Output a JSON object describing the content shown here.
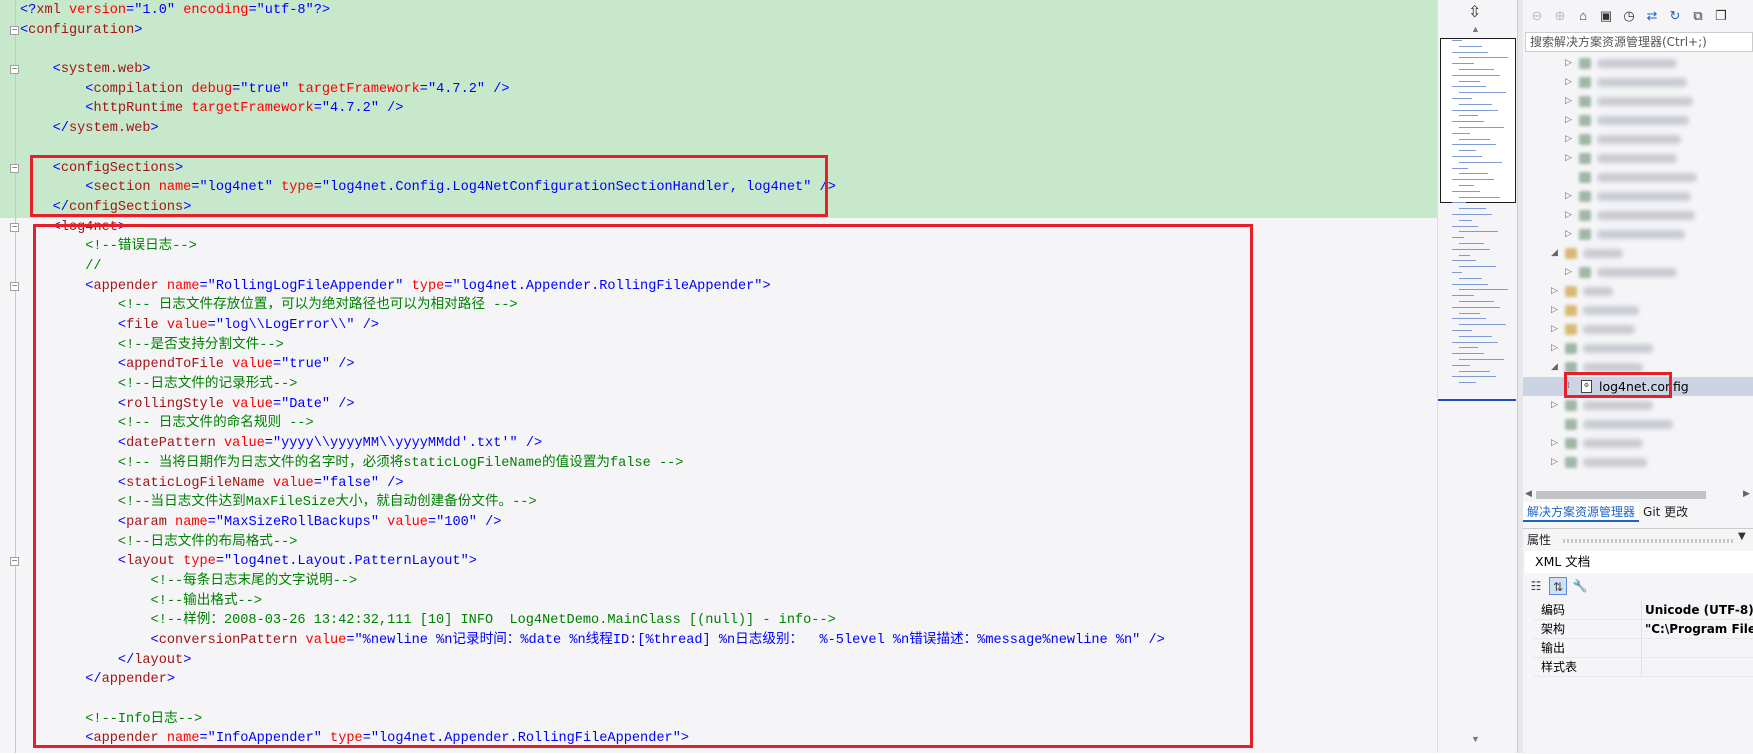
{
  "editor": {
    "lines": [
      {
        "fold": false,
        "indent": 0,
        "tokens": [
          [
            "br",
            "<?"
          ],
          [
            "tag",
            "xml"
          ],
          [
            "attr",
            " version"
          ],
          [
            "br",
            "="
          ],
          [
            "val",
            "\"1.0\""
          ],
          [
            "attr",
            " encoding"
          ],
          [
            "br",
            "="
          ],
          [
            "val",
            "\"utf-8\""
          ],
          [
            "br",
            "?>"
          ]
        ]
      },
      {
        "fold": true,
        "indent": 0,
        "tokens": [
          [
            "br",
            "<"
          ],
          [
            "tag",
            "configuration"
          ],
          [
            "br",
            ">"
          ]
        ]
      },
      {
        "fold": false,
        "indent": 0,
        "tokens": []
      },
      {
        "fold": true,
        "indent": 1,
        "tokens": [
          [
            "br",
            "<"
          ],
          [
            "tag",
            "system.web"
          ],
          [
            "br",
            ">"
          ]
        ]
      },
      {
        "fold": false,
        "indent": 2,
        "tokens": [
          [
            "br",
            "<"
          ],
          [
            "tag",
            "compilation"
          ],
          [
            "attr",
            " debug"
          ],
          [
            "br",
            "="
          ],
          [
            "val",
            "\"true\""
          ],
          [
            "attr",
            " targetFramework"
          ],
          [
            "br",
            "="
          ],
          [
            "val",
            "\"4.7.2\""
          ],
          [
            "br",
            " />"
          ]
        ]
      },
      {
        "fold": false,
        "indent": 2,
        "tokens": [
          [
            "br",
            "<"
          ],
          [
            "tag",
            "httpRuntime"
          ],
          [
            "attr",
            " targetFramework"
          ],
          [
            "br",
            "="
          ],
          [
            "val",
            "\"4.7.2\""
          ],
          [
            "br",
            " />"
          ]
        ]
      },
      {
        "fold": false,
        "indent": 1,
        "tokens": [
          [
            "br",
            "</"
          ],
          [
            "tag",
            "system.web"
          ],
          [
            "br",
            ">"
          ]
        ]
      },
      {
        "fold": false,
        "indent": 0,
        "tokens": []
      },
      {
        "fold": true,
        "indent": 1,
        "tokens": [
          [
            "br",
            "<"
          ],
          [
            "tag",
            "configSections"
          ],
          [
            "br",
            ">"
          ]
        ]
      },
      {
        "fold": false,
        "indent": 2,
        "tokens": [
          [
            "br",
            "<"
          ],
          [
            "tag",
            "section"
          ],
          [
            "attr",
            " name"
          ],
          [
            "br",
            "="
          ],
          [
            "val",
            "\"log4net\""
          ],
          [
            "attr",
            " type"
          ],
          [
            "br",
            "="
          ],
          [
            "val",
            "\"log4net.Config.Log4NetConfigurationSectionHandler, log4net\""
          ],
          [
            "br",
            " />"
          ]
        ]
      },
      {
        "fold": false,
        "indent": 1,
        "tokens": [
          [
            "br",
            "</"
          ],
          [
            "tag",
            "configSections"
          ],
          [
            "br",
            ">"
          ]
        ]
      },
      {
        "fold": true,
        "indent": 1,
        "tokens": [
          [
            "br",
            "<"
          ],
          [
            "tag",
            "log4net"
          ],
          [
            "br",
            ">"
          ]
        ]
      },
      {
        "fold": false,
        "indent": 2,
        "tokens": [
          [
            "cmt",
            "<!--错误日志-->"
          ]
        ]
      },
      {
        "fold": false,
        "indent": 2,
        "tokens": [
          [
            "cmt",
            "//"
          ]
        ]
      },
      {
        "fold": true,
        "indent": 2,
        "tokens": [
          [
            "br",
            "<"
          ],
          [
            "tag",
            "appender"
          ],
          [
            "attr",
            " name"
          ],
          [
            "br",
            "="
          ],
          [
            "val",
            "\"RollingLogFileAppender\""
          ],
          [
            "attr",
            " type"
          ],
          [
            "br",
            "="
          ],
          [
            "val",
            "\"log4net.Appender.RollingFileAppender\""
          ],
          [
            "br",
            ">"
          ]
        ]
      },
      {
        "fold": false,
        "indent": 3,
        "tokens": [
          [
            "cmt",
            "<!-- 日志文件存放位置，可以为绝对路径也可以为相对路径 -->"
          ]
        ]
      },
      {
        "fold": false,
        "indent": 3,
        "tokens": [
          [
            "br",
            "<"
          ],
          [
            "tag",
            "file"
          ],
          [
            "attr",
            " value"
          ],
          [
            "br",
            "="
          ],
          [
            "val",
            "\"log\\\\LogError\\\\\""
          ],
          [
            "br",
            " />"
          ]
        ]
      },
      {
        "fold": false,
        "indent": 3,
        "tokens": [
          [
            "cmt",
            "<!--是否支持分割文件-->"
          ]
        ]
      },
      {
        "fold": false,
        "indent": 3,
        "tokens": [
          [
            "br",
            "<"
          ],
          [
            "tag",
            "appendToFile"
          ],
          [
            "attr",
            " value"
          ],
          [
            "br",
            "="
          ],
          [
            "val",
            "\"true\""
          ],
          [
            "br",
            " />"
          ]
        ]
      },
      {
        "fold": false,
        "indent": 3,
        "tokens": [
          [
            "cmt",
            "<!--日志文件的记录形式-->"
          ]
        ]
      },
      {
        "fold": false,
        "indent": 3,
        "tokens": [
          [
            "br",
            "<"
          ],
          [
            "tag",
            "rollingStyle"
          ],
          [
            "attr",
            " value"
          ],
          [
            "br",
            "="
          ],
          [
            "val",
            "\"Date\""
          ],
          [
            "br",
            " />"
          ]
        ]
      },
      {
        "fold": false,
        "indent": 3,
        "tokens": [
          [
            "cmt",
            "<!-- 日志文件的命名规则 -->"
          ]
        ]
      },
      {
        "fold": false,
        "indent": 3,
        "tokens": [
          [
            "br",
            "<"
          ],
          [
            "tag",
            "datePattern"
          ],
          [
            "attr",
            " value"
          ],
          [
            "br",
            "="
          ],
          [
            "val",
            "\"yyyy\\\\yyyyMM\\\\yyyyMMdd'.txt'\""
          ],
          [
            "br",
            " />"
          ]
        ]
      },
      {
        "fold": false,
        "indent": 3,
        "tokens": [
          [
            "cmt",
            "<!-- 当将日期作为日志文件的名字时，必须将staticLogFileName的值设置为false -->"
          ]
        ]
      },
      {
        "fold": false,
        "indent": 3,
        "tokens": [
          [
            "br",
            "<"
          ],
          [
            "tag",
            "staticLogFileName"
          ],
          [
            "attr",
            " value"
          ],
          [
            "br",
            "="
          ],
          [
            "val",
            "\"false\""
          ],
          [
            "br",
            " />"
          ]
        ]
      },
      {
        "fold": false,
        "indent": 3,
        "tokens": [
          [
            "cmt",
            "<!--当日志文件达到MaxFileSize大小，就自动创建备份文件。-->"
          ]
        ]
      },
      {
        "fold": false,
        "indent": 3,
        "tokens": [
          [
            "br",
            "<"
          ],
          [
            "tag",
            "param"
          ],
          [
            "attr",
            " name"
          ],
          [
            "br",
            "="
          ],
          [
            "val",
            "\"MaxSizeRollBackups\""
          ],
          [
            "attr",
            " value"
          ],
          [
            "br",
            "="
          ],
          [
            "val",
            "\"100\""
          ],
          [
            "br",
            " />"
          ]
        ]
      },
      {
        "fold": false,
        "indent": 3,
        "tokens": [
          [
            "cmt",
            "<!--日志文件的布局格式-->"
          ]
        ]
      },
      {
        "fold": true,
        "indent": 3,
        "tokens": [
          [
            "br",
            "<"
          ],
          [
            "tag",
            "layout"
          ],
          [
            "attr",
            " type"
          ],
          [
            "br",
            "="
          ],
          [
            "val",
            "\"log4net.Layout.PatternLayout\""
          ],
          [
            "br",
            ">"
          ]
        ]
      },
      {
        "fold": false,
        "indent": 4,
        "tokens": [
          [
            "cmt",
            "<!--每条日志末尾的文字说明-->"
          ]
        ]
      },
      {
        "fold": false,
        "indent": 4,
        "tokens": [
          [
            "cmt",
            "<!--输出格式-->"
          ]
        ]
      },
      {
        "fold": false,
        "indent": 4,
        "tokens": [
          [
            "cmt",
            "<!--样例：2008-03-26 13:42:32,111 [10] INFO  Log4NetDemo.MainClass [(null)] - info-->"
          ]
        ]
      },
      {
        "fold": false,
        "indent": 4,
        "tokens": [
          [
            "br",
            "<"
          ],
          [
            "tag",
            "conversionPattern"
          ],
          [
            "attr",
            " value"
          ],
          [
            "br",
            "="
          ],
          [
            "val",
            "\"%newline %n记录时间：%date %n线程ID:[%thread] %n日志级别：  %-5level %n错误描述：%message%newline %n\""
          ],
          [
            "br",
            " />"
          ]
        ]
      },
      {
        "fold": false,
        "indent": 3,
        "tokens": [
          [
            "br",
            "</"
          ],
          [
            "tag",
            "layout"
          ],
          [
            "br",
            ">"
          ]
        ]
      },
      {
        "fold": false,
        "indent": 2,
        "tokens": [
          [
            "br",
            "</"
          ],
          [
            "tag",
            "appender"
          ],
          [
            "br",
            ">"
          ]
        ]
      },
      {
        "fold": false,
        "indent": 0,
        "tokens": []
      },
      {
        "fold": false,
        "indent": 2,
        "tokens": [
          [
            "cmt",
            "<!--Info日志-->"
          ]
        ]
      },
      {
        "fold": false,
        "indent": 2,
        "tokens": [
          [
            "br",
            "<"
          ],
          [
            "tag",
            "appender"
          ],
          [
            "attr",
            " name"
          ],
          [
            "br",
            "="
          ],
          [
            "val",
            "\"InfoAppender\""
          ],
          [
            "attr",
            " type"
          ],
          [
            "br",
            "="
          ],
          [
            "val",
            "\"log4net.Appender.RollingFileAppender\""
          ],
          [
            "br",
            ">"
          ]
        ]
      }
    ]
  },
  "solution_explorer": {
    "search_placeholder": "搜索解决方案资源管理器(Ctrl+;)",
    "selected_file": "log4net.config",
    "tabs": [
      "解决方案资源管理器",
      "Git 更改"
    ]
  },
  "properties": {
    "title": "属性",
    "object": "XML 文档",
    "rows": [
      {
        "key": "编码",
        "value": "Unicode (UTF-8)"
      },
      {
        "key": "架构",
        "value": "\"C:\\Program Files"
      },
      {
        "key": "输出",
        "value": ""
      },
      {
        "key": "样式表",
        "value": ""
      }
    ]
  },
  "colors": {
    "highlight_box": "#e5202a",
    "changed_background": "#c7e8cb",
    "accent": "#1e62c8"
  }
}
